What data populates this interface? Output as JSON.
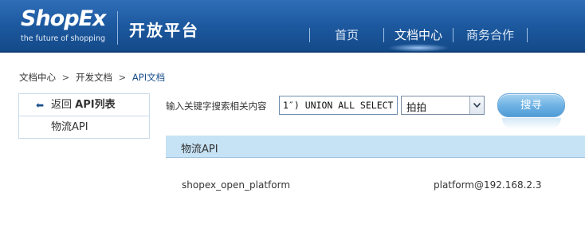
{
  "header": {
    "logo_text": "ShopEx",
    "logo_tagline": "the future of shopping",
    "site_title": "开放平台",
    "nav": [
      {
        "label": "首页",
        "active": false
      },
      {
        "label": "文档中心",
        "active": true
      },
      {
        "label": "商务合作",
        "active": false
      }
    ],
    "colors": {
      "header_bg": "#1e5aa1",
      "accent": "#1b4f8c"
    }
  },
  "breadcrumb": {
    "items": [
      "文档中心",
      "开发文档",
      "API文档"
    ],
    "separator": ">"
  },
  "sidebar": {
    "back_prefix": "返回 ",
    "back_strong": "API列表",
    "back_icon": "left-arrow-icon",
    "items": [
      "物流API"
    ]
  },
  "search": {
    "label": "输入关键字搜索相关内容",
    "input_value": "1″) UNION ALL SELECT",
    "select_value": "拍拍",
    "button_label": "搜寻"
  },
  "results": {
    "header": "物流API",
    "rows": [
      {
        "name": "shopex_open_platform",
        "owner": "platform@192.168.2.3"
      }
    ]
  }
}
